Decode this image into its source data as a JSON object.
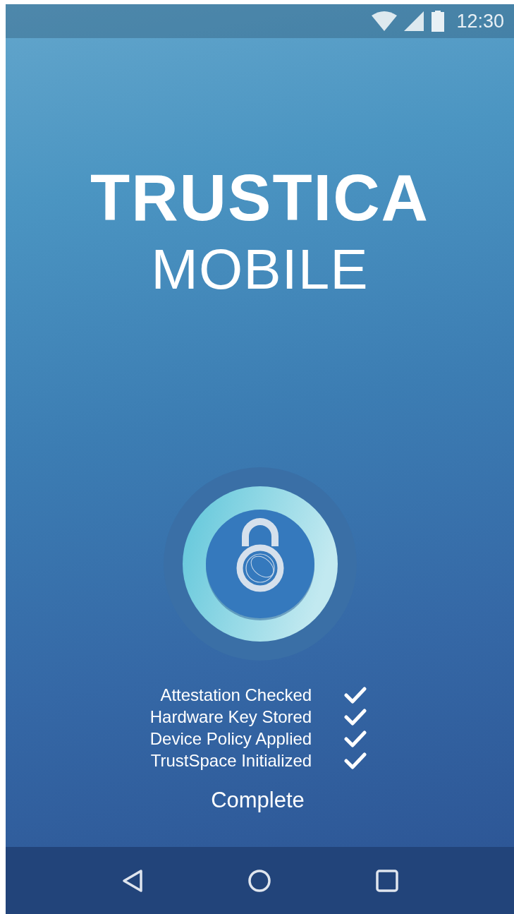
{
  "status_bar": {
    "time": "12:30"
  },
  "logo": {
    "brand": "TRUSTICA",
    "product": "MOBILE"
  },
  "steps": [
    {
      "label": "Attestation Checked",
      "checked": true
    },
    {
      "label": "Hardware Key Stored",
      "checked": true
    },
    {
      "label": "Device Policy Applied",
      "checked": true
    },
    {
      "label": "TrustSpace Initialized",
      "checked": true
    }
  ],
  "status": "Complete"
}
